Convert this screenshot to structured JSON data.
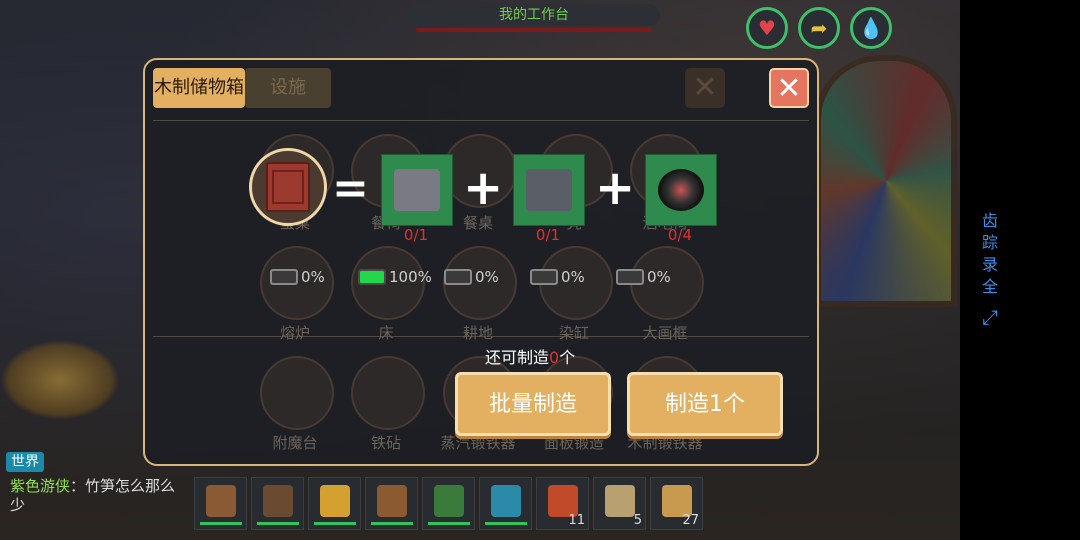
{
  "hud": {
    "workbench_title": "我的工作台",
    "stats": [
      {
        "name": "health",
        "glyph": "♥",
        "color": "#e2434a"
      },
      {
        "name": "hunger",
        "glyph": "➦",
        "color": "#e3c23a"
      },
      {
        "name": "thirst",
        "glyph": "💧",
        "color": "#2ac6d6"
      }
    ],
    "side_tools": [
      "齿",
      "踪",
      "录",
      "全"
    ],
    "fullscreen_glyph": "⤢"
  },
  "dialog": {
    "tabs": [
      {
        "label": "木制储物箱",
        "active": true
      },
      {
        "label": "设施",
        "active": false
      }
    ],
    "close_glyph": "✕",
    "recipe": {
      "equals": "=",
      "plus": "+",
      "result_name": "木制储物箱",
      "ingredients": [
        {
          "count": "0/1"
        },
        {
          "count": "0/1"
        },
        {
          "count": "0/4"
        }
      ]
    },
    "background_items": [
      "蛋桌",
      "餐椅",
      "餐桌",
      "凳",
      "酒吧椅"
    ],
    "progress_items": [
      {
        "label": "熔炉",
        "percent": "0%",
        "full": false
      },
      {
        "label": "床",
        "percent": "100%",
        "full": true
      },
      {
        "label": "耕地",
        "percent": "0%",
        "full": false
      },
      {
        "label": "染缸",
        "percent": "0%",
        "full": false
      },
      {
        "label": "大画框",
        "percent": "0%",
        "full": false
      }
    ],
    "bottom_items": [
      "附魔台",
      "铁砧",
      "蒸汽锻铁器",
      "面板锻造",
      "木制锻铁器"
    ],
    "remaining": {
      "prefix": "还可制造",
      "count": "0",
      "suffix": "个"
    },
    "buttons": {
      "batch": "批量制造",
      "single": "制造1个"
    }
  },
  "chat": {
    "channel": "世界",
    "sender": "紫色游侠",
    "message": "：竹笋怎么那么少"
  },
  "hotbar": [
    {
      "icon": "stone-hammer-icon",
      "color": "#8a5a35",
      "qty": "",
      "durability": true
    },
    {
      "icon": "pickaxe-icon",
      "color": "#6a4a30",
      "qty": "",
      "durability": true
    },
    {
      "icon": "banana-boomerang-icon",
      "color": "#d4a030",
      "qty": "",
      "durability": true
    },
    {
      "icon": "wooden-club-icon",
      "color": "#8c5a30",
      "qty": "",
      "durability": true
    },
    {
      "icon": "fishing-rod-icon",
      "color": "#3a7a3a",
      "qty": "",
      "durability": true
    },
    {
      "icon": "magic-staff-icon",
      "color": "#2a8aa8",
      "qty": "",
      "durability": true
    },
    {
      "icon": "ham-meat-icon",
      "color": "#c04a2a",
      "qty": "11",
      "durability": false
    },
    {
      "icon": "seed-bag-icon",
      "color": "#b8a070",
      "qty": "5",
      "durability": false
    },
    {
      "icon": "carrot-bag-icon",
      "color": "#c89a50",
      "qty": "27",
      "durability": false
    }
  ]
}
